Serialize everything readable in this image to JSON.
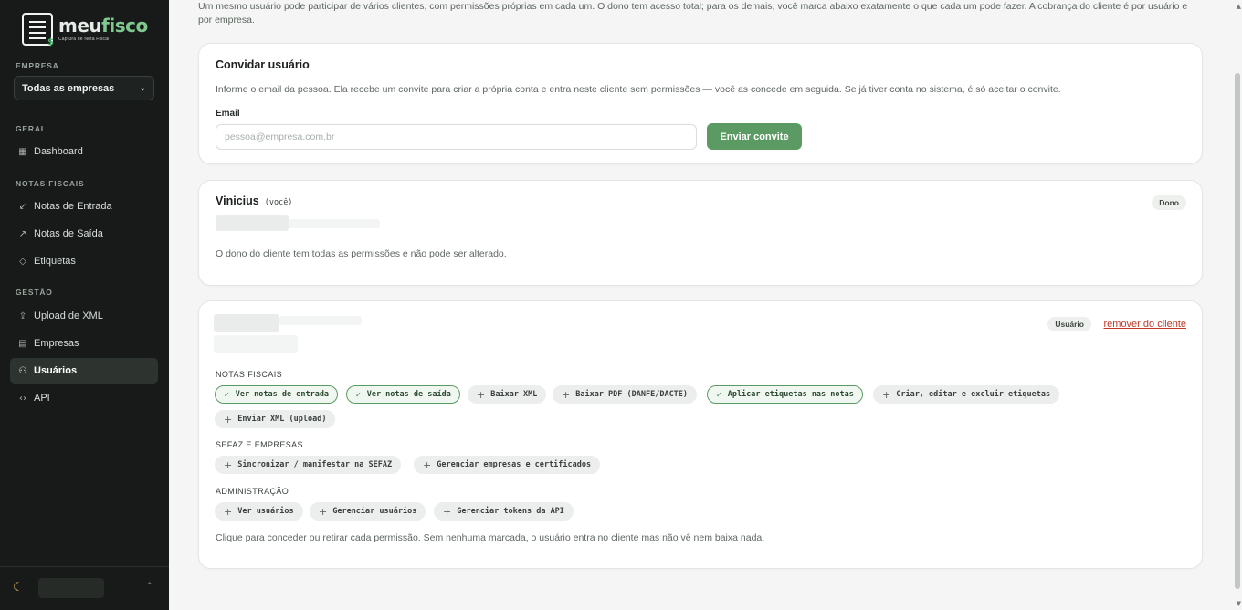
{
  "brand": {
    "name_part1": "meu",
    "name_part2": "fisco",
    "tagline": "Captura de Nota Fiscal"
  },
  "sidebar": {
    "company_label": "EMPRESA",
    "company_select": "Todas as empresas",
    "sections": [
      {
        "label": "GERAL",
        "items": [
          {
            "label": "Dashboard",
            "icon": "grid-icon"
          }
        ]
      },
      {
        "label": "NOTAS FISCAIS",
        "items": [
          {
            "label": "Notas de Entrada",
            "icon": "arrow-down-left-icon"
          },
          {
            "label": "Notas de Saída",
            "icon": "arrow-up-right-icon"
          },
          {
            "label": "Etiquetas",
            "icon": "tag-icon"
          }
        ]
      },
      {
        "label": "GESTÃO",
        "items": [
          {
            "label": "Upload de XML",
            "icon": "upload-icon"
          },
          {
            "label": "Empresas",
            "icon": "building-icon"
          },
          {
            "label": "Usuários",
            "icon": "users-icon",
            "active": true
          },
          {
            "label": "API",
            "icon": "code-icon"
          }
        ]
      }
    ]
  },
  "intro_text": "Um mesmo usuário pode participar de vários clientes, com permissões próprias em cada um. O dono tem acesso total; para os demais, você marca abaixo exatamente o que cada um pode fazer. A cobrança do cliente é por usuário e por empresa.",
  "invite": {
    "title": "Convidar usuário",
    "description": "Informe o email da pessoa. Ela recebe um convite para criar a própria conta e entra neste cliente sem permissões — você as concede em seguida. Se já tiver conta no sistema, é só aceitar o convite.",
    "email_label": "Email",
    "email_placeholder": "pessoa@empresa.com.br",
    "email_value": "",
    "submit_label": "Enviar convite"
  },
  "owner_card": {
    "name": "Vinicius",
    "you_tag": "(você)",
    "role_badge": "Dono",
    "note": "O dono do cliente tem todas as permissões e não pode ser alterado."
  },
  "user_card": {
    "role_badge": "Usuário",
    "remove_label": "remover do cliente",
    "groups": [
      {
        "label": "NOTAS FISCAIS",
        "permissions": [
          {
            "label": "Ver notas de entrada",
            "granted": true
          },
          {
            "label": "Ver notas de saída",
            "granted": true
          },
          {
            "label": "Baixar XML",
            "granted": false
          },
          {
            "label": "Baixar PDF (DANFE/DACTE)",
            "granted": false
          },
          {
            "label": "Aplicar etiquetas nas notas",
            "granted": true
          },
          {
            "label": "Criar, editar e excluir etiquetas",
            "granted": false
          },
          {
            "label": "Enviar XML (upload)",
            "granted": false
          }
        ]
      },
      {
        "label": "SEFAZ E EMPRESAS",
        "permissions": [
          {
            "label": "Sincronizar / manifestar na SEFAZ",
            "granted": false
          },
          {
            "label": "Gerenciar empresas e certificados",
            "granted": false
          }
        ]
      },
      {
        "label": "ADMINISTRAÇÃO",
        "permissions": [
          {
            "label": "Ver usuários",
            "granted": false
          },
          {
            "label": "Gerenciar usuários",
            "granted": false
          },
          {
            "label": "Gerenciar tokens da API",
            "granted": false
          }
        ]
      }
    ],
    "footer_note": "Clique para conceder ou retirar cada permissão. Sem nenhuma marcada, o usuário entra no cliente mas não vê nem baixa nada.",
    "granted_mark": "✓",
    "not_granted_mark": "+"
  },
  "theme": {
    "accent": "#5c9a64",
    "sidebar_bg": "#171a18",
    "danger": "#c0392b"
  }
}
